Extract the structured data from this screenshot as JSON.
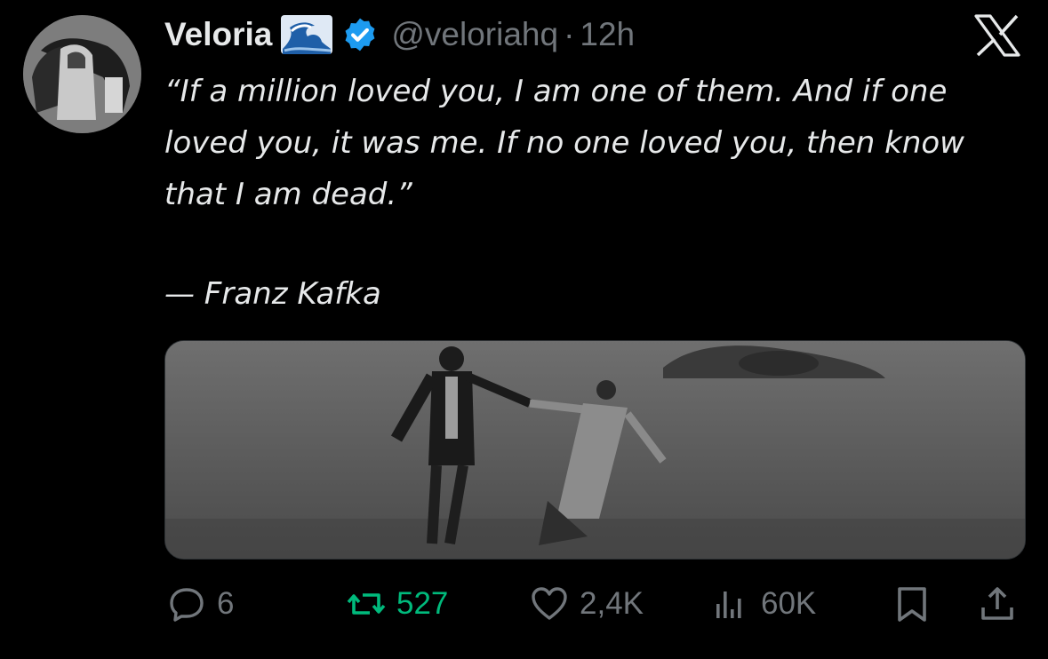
{
  "post": {
    "author_name": "Veloria",
    "handle": "@veloriahq",
    "separator": "·",
    "time": "12h",
    "quote_text": "“If a million loved you, I am one of them. And if one loved you, it was me. If no one loved you, then know that I am dead.”",
    "attribution": "— Franz Kafka"
  },
  "actions": {
    "reply_count": "6",
    "repost_count": "527",
    "like_count": "2,4K",
    "view_count": "60K"
  },
  "colors": {
    "background": "#000000",
    "text_primary": "#e7e9ea",
    "text_secondary": "#71767b",
    "verified": "#1d9bf0",
    "repost_active": "#00ba7c"
  },
  "icons": {
    "logo": "x-logo-icon",
    "badge": "verified-badge-icon",
    "emoji": "water-wave-emoji-icon",
    "reply": "reply-bubble-icon",
    "repost": "repost-icon",
    "like": "heart-icon",
    "views": "views-bar-chart-icon",
    "bookmark": "bookmark-icon",
    "share": "share-upload-icon"
  }
}
